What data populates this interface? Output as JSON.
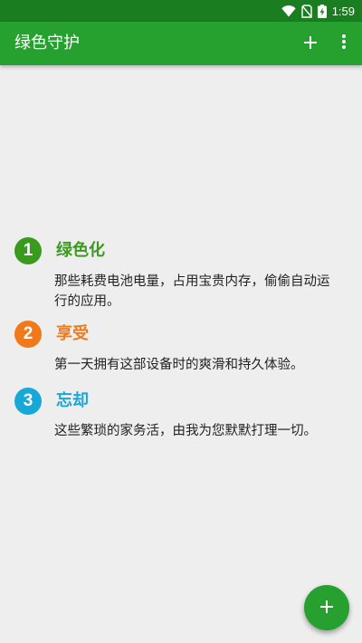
{
  "status_bar": {
    "time": "1:59",
    "icons": [
      "wifi-icon",
      "no-sim-icon",
      "battery-charging-icon"
    ]
  },
  "app_bar": {
    "title": "绿色守护",
    "actions": [
      "add-icon",
      "more-vert-icon"
    ]
  },
  "features": [
    {
      "number": "1",
      "title": "绿色化",
      "description": "那些耗费电池电量，占用宝贵内存，偷偷自动运行的应用。",
      "color": "#3a9a1e"
    },
    {
      "number": "2",
      "title": "享受",
      "description": "第一天拥有这部设备时的爽滑和持久体验。",
      "color": "#f07a1a"
    },
    {
      "number": "3",
      "title": "忘却",
      "description": "这些繁琐的家务活，由我为您默默打理一切。",
      "color": "#18a8d8"
    }
  ],
  "fab": {
    "icon": "add-icon"
  },
  "colors": {
    "primary": "#26a02e",
    "primary_dark": "#1a7d1f",
    "background": "#eeeeee"
  }
}
